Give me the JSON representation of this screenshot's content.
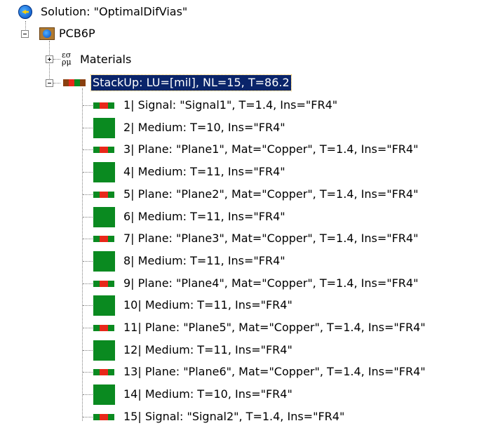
{
  "tree": {
    "solution": {
      "label": "Solution: \"OptimalDifVias\"",
      "icon": "solution-globe-icon"
    },
    "pcb": {
      "label": "PCB6P",
      "icon": "pcb-board-icon",
      "expander": "−"
    },
    "materials": {
      "label": "Materials",
      "icon": "materials-greek-icon",
      "icon_glyph": "εσ ρμ",
      "expander": "+"
    },
    "stackup": {
      "label": "StackUp: LU=[mil], NL=15, T=86.2",
      "icon": "stackup-icon",
      "expander": "−",
      "selected": true
    },
    "layers": [
      {
        "label": "1| Signal: \"Signal1\", T=1.4, Ins=\"FR4\"",
        "kind": "signal"
      },
      {
        "label": "2| Medium: T=10, Ins=\"FR4\"",
        "kind": "medium"
      },
      {
        "label": "3| Plane: \"Plane1\", Mat=\"Copper\", T=1.4, Ins=\"FR4\"",
        "kind": "plane"
      },
      {
        "label": "4| Medium: T=11, Ins=\"FR4\"",
        "kind": "medium"
      },
      {
        "label": "5| Plane: \"Plane2\", Mat=\"Copper\", T=1.4, Ins=\"FR4\"",
        "kind": "plane"
      },
      {
        "label": "6| Medium: T=11, Ins=\"FR4\"",
        "kind": "medium"
      },
      {
        "label": "7| Plane: \"Plane3\", Mat=\"Copper\", T=1.4, Ins=\"FR4\"",
        "kind": "plane"
      },
      {
        "label": "8| Medium: T=11, Ins=\"FR4\"",
        "kind": "medium"
      },
      {
        "label": "9| Plane: \"Plane4\", Mat=\"Copper\", T=1.4, Ins=\"FR4\"",
        "kind": "plane"
      },
      {
        "label": "10| Medium: T=11, Ins=\"FR4\"",
        "kind": "medium"
      },
      {
        "label": "11| Plane: \"Plane5\", Mat=\"Copper\", T=1.4, Ins=\"FR4\"",
        "kind": "plane"
      },
      {
        "label": "12| Medium: T=11, Ins=\"FR4\"",
        "kind": "medium"
      },
      {
        "label": "13| Plane: \"Plane6\", Mat=\"Copper\", T=1.4, Ins=\"FR4\"",
        "kind": "plane"
      },
      {
        "label": "14| Medium: T=10, Ins=\"FR4\"",
        "kind": "medium"
      },
      {
        "label": "15| Signal: \"Signal2\", T=1.4, Ins=\"FR4\"",
        "kind": "signal"
      }
    ],
    "colors": {
      "layer_green": "#0a8a20",
      "layer_red": "#e8281a",
      "selection_bg": "#0a246a",
      "selection_text": "#ffffff"
    }
  }
}
